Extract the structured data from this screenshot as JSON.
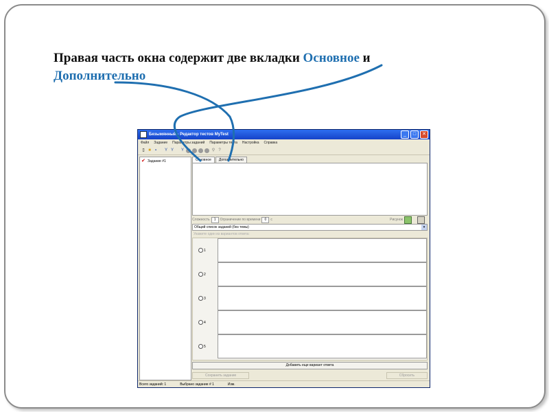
{
  "headline": {
    "part1": "Правая часть окна содержит две вкладки ",
    "highlight1": "Основное",
    "part2": " и ",
    "highlight2": "Дополнительно",
    "highlight_color": "#1f6fb0"
  },
  "window": {
    "title": "Безымянный - Редактор тестов MyTest",
    "controls": {
      "minimize": "_",
      "maximize": "□",
      "close": "✕"
    },
    "menu": [
      "Файл",
      "Задание",
      "Параметры заданий",
      "Параметры теста",
      "Настройка",
      "Справка"
    ],
    "toolbar_icons": [
      "new-file-icon",
      "open-folder-icon",
      "save-icon",
      "add-task-icon",
      "add-task-icon",
      "remove-task-icon",
      "nav-circle-icon",
      "nav-circle-icon",
      "nav-circle-icon",
      "nav-circle-icon",
      "search-icon",
      "help-icon"
    ],
    "tree_items": [
      "Задание #1"
    ],
    "tabs": [
      "Основное",
      "Дополнительно"
    ],
    "params": {
      "weight_label": "Сложность",
      "weight_value": "1",
      "time_label": "Ограничение по времени",
      "time_value": "0",
      "time_suffix": "с",
      "picture_label": "Рисунок"
    },
    "topic_select": "Общий список заданий (без темы)",
    "answers_hint": "Укажите один из вариантов ответа:",
    "answers": [
      "1",
      "2",
      "3",
      "4",
      "5"
    ],
    "add_answer_button": "Добавить еще вариант ответа",
    "save_task_button": "Сохранить задание",
    "reset_button": "Сбросить",
    "status": {
      "total": "Всего заданий: 1",
      "selected": "Выбрано задание # 1",
      "modified": "Изм."
    }
  }
}
